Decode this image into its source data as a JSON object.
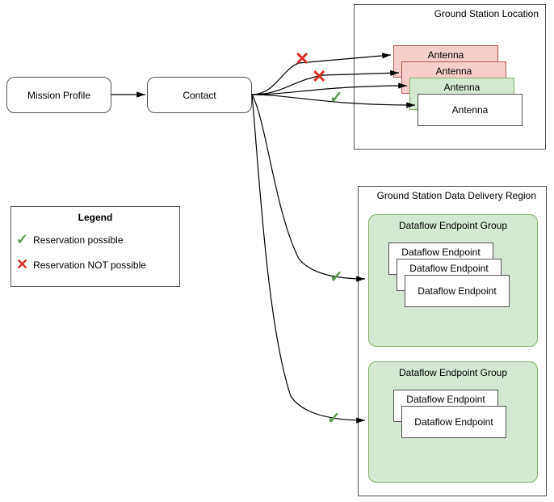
{
  "nodes": {
    "mission_profile": "Mission Profile",
    "contact": "Contact"
  },
  "ground_station_location": {
    "title": "Ground Station Location",
    "antennas": [
      "Antenna",
      "Antenna",
      "Antenna",
      "Antenna"
    ]
  },
  "data_delivery_region": {
    "title": "Ground Station Data Delivery Region",
    "groups": [
      {
        "title": "Dataflow Endpoint Group",
        "endpoints": [
          "Dataflow Endpoint",
          "Dataflow Endpoint",
          "Dataflow Endpoint"
        ]
      },
      {
        "title": "Dataflow Endpoint Group",
        "endpoints": [
          "Dataflow Endpoint",
          "Dataflow Endpoint"
        ]
      }
    ]
  },
  "legend": {
    "title": "Legend",
    "possible": "Reservation possible",
    "not_possible": "Reservation NOT possible"
  },
  "marks": {
    "check": "✓",
    "cross": "✕"
  }
}
